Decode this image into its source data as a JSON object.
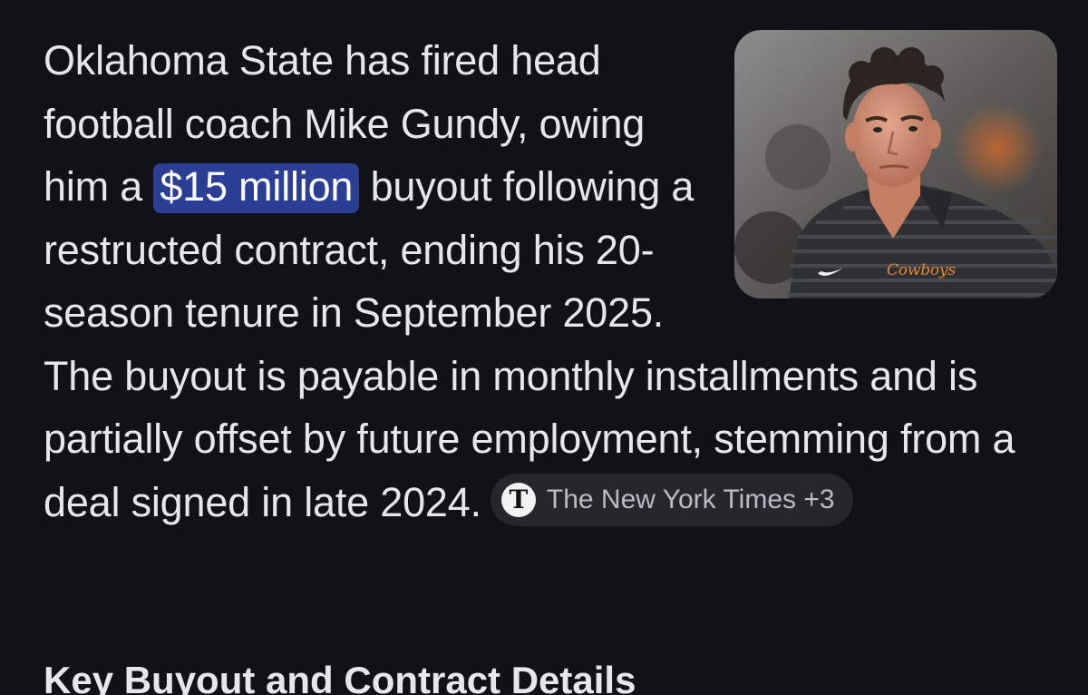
{
  "summary": {
    "text_before": "Oklahoma State has fired head football coach Mike Gundy, owing him a ",
    "highlight": "$15 million",
    "text_after": " buyout following a restructed contract, ending his 20-season tenure in September 2025. The buyout is payable in monthly installments and is partially offset by future employment, stemming from a deal signed in late 2024.",
    "image": {
      "icon": "coach-photo",
      "shirt_text": "Cowboys"
    },
    "source": {
      "icon": "nyt-logo-icon",
      "icon_glyph": "T",
      "label": "The New York Times +3"
    }
  },
  "section": {
    "heading": "Key Buyout and Contract Details"
  },
  "colors": {
    "background": "#111217",
    "text": "#e6e7eb",
    "highlight_bg": "#2a3e94",
    "chip_bg": "#26272d",
    "chip_text": "#b9bcc4"
  }
}
